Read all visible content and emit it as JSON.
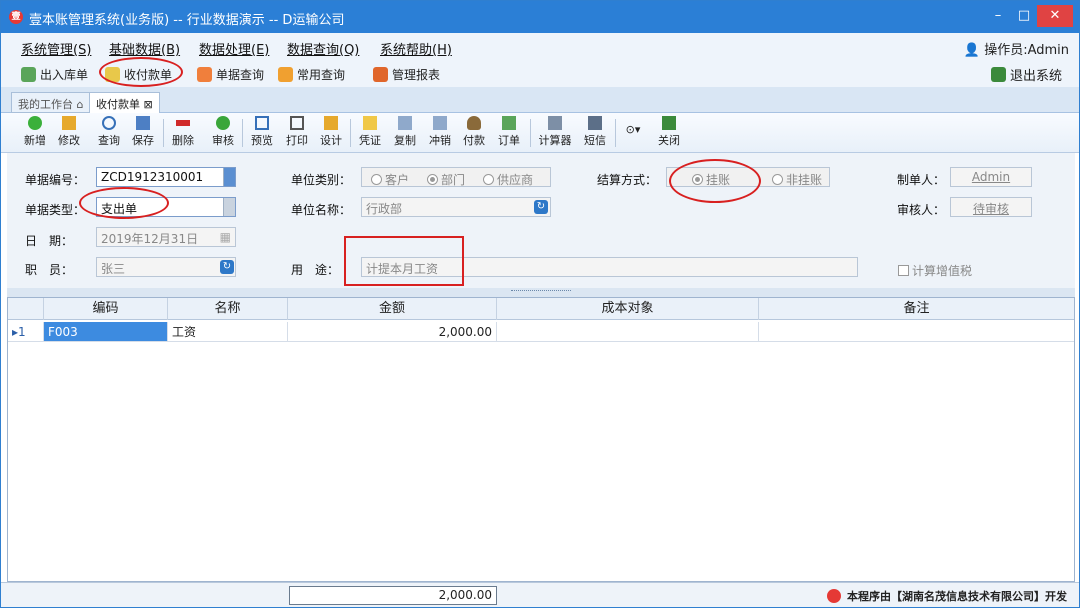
{
  "window": {
    "title": "壹本账管理系统(业务版) -- 行业数据演示 -- D运输公司",
    "minimize": "–",
    "maximize": "□",
    "close": "✕"
  },
  "menu": {
    "items": [
      "系统管理(S)",
      "基础数据(B)",
      "数据处理(E)",
      "数据查询(Q)",
      "系统帮助(H)"
    ],
    "operator": "操作员:Admin"
  },
  "quickbar": {
    "items": [
      "出入库单",
      "收付款单",
      "单据查询",
      "常用查询",
      "管理报表"
    ],
    "logout": "退出系统"
  },
  "tabs": [
    "我的工作台",
    "收付款单"
  ],
  "toolbar": [
    "新增",
    "修改",
    "查询",
    "保存",
    "删除",
    "审核",
    "预览",
    "打印",
    "设计",
    "凭证",
    "复制",
    "冲销",
    "付款",
    "订单",
    "计算器",
    "短信",
    "关闭"
  ],
  "form": {
    "doc_no_label": "单据编号：",
    "doc_no": "ZCD1912310001",
    "doc_type_label": "单据类型：",
    "doc_type": "支出单",
    "date_label": "日　期：",
    "date": "2019年12月31日",
    "staff_label": "职　员：",
    "staff": "张三",
    "unit_type_label": "单位类别：",
    "unit_types": [
      "客户",
      "部门",
      "供应商"
    ],
    "unit_name_label": "单位名称：",
    "unit_name": "行政部",
    "purpose_label": "用　途：",
    "purpose": "计提本月工资",
    "settle_label": "结算方式：",
    "settle_options": [
      "挂账",
      "非挂账"
    ],
    "maker_label": "制单人：",
    "maker": "Admin",
    "auditor_label": "审核人：",
    "auditor": "待审核",
    "vat_label": "计算增值税"
  },
  "grid": {
    "columns": [
      "编码",
      "名称",
      "金额",
      "成本对象",
      "备注"
    ],
    "rows": [
      {
        "index": "1",
        "code": "F003",
        "name": "工资",
        "amount": "2,000.00",
        "cost": "",
        "note": ""
      }
    ],
    "total": "2,000.00"
  },
  "footer": {
    "credit": "本程序由【湖南名茂信息技术有限公司】开发"
  }
}
